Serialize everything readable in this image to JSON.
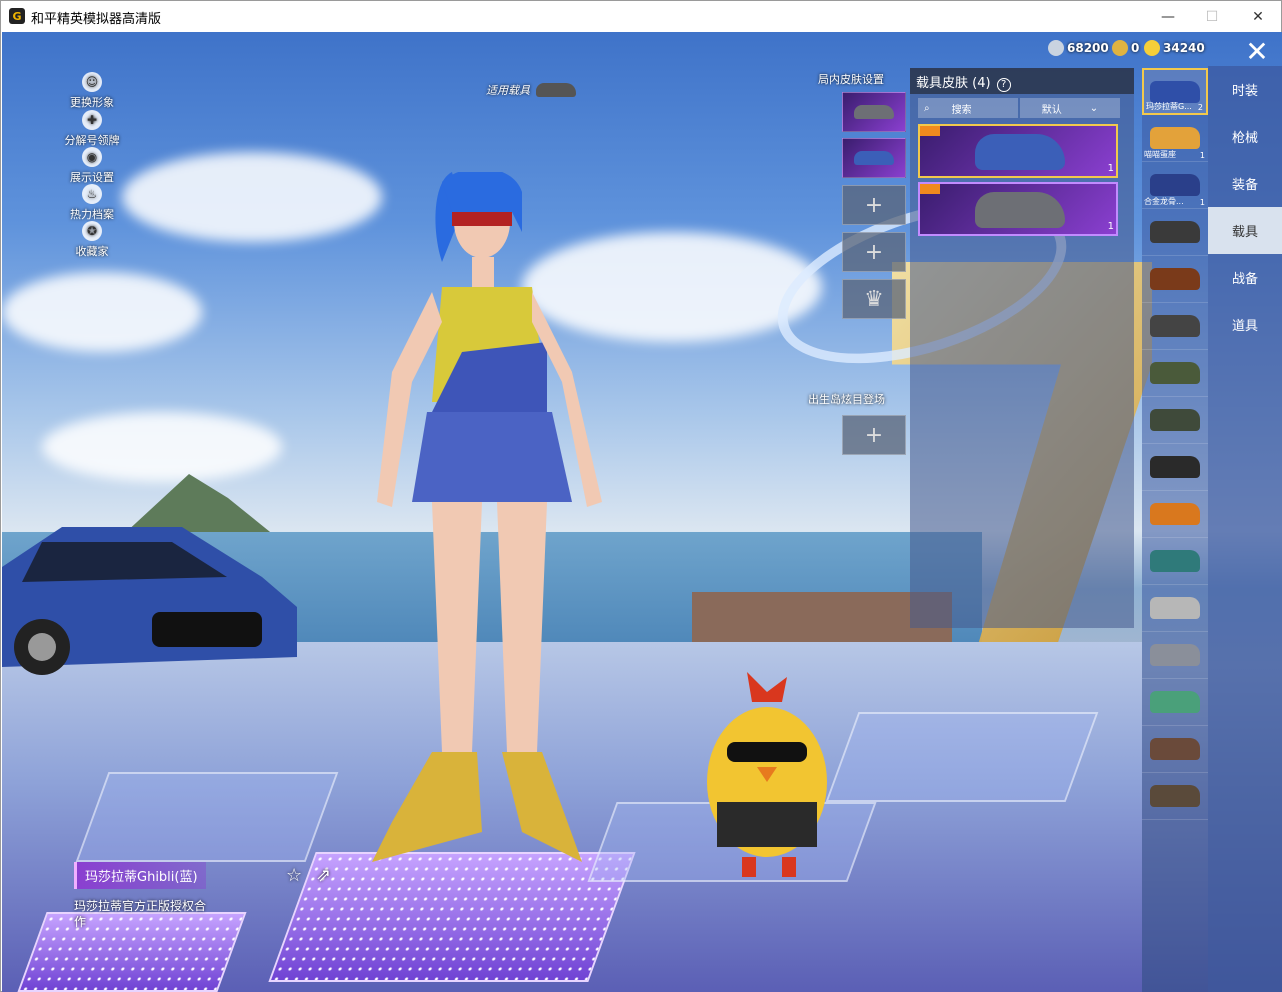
{
  "window": {
    "title": "和平精英模拟器高清版",
    "icon_letter": "G",
    "minimize_glyph": "—",
    "maximize_glyph": "☐",
    "close_glyph": "✕"
  },
  "side_menu": [
    {
      "label": "更换形象",
      "icon": "person-icon"
    },
    {
      "label": "分解号领牌",
      "icon": "puzzle-icon"
    },
    {
      "label": "展示设置",
      "icon": "eye-icon"
    },
    {
      "label": "热力档案",
      "icon": "flame-icon"
    },
    {
      "label": "收藏家",
      "icon": "medal-icon"
    }
  ],
  "apply_vehicle": "适用载具",
  "currency": [
    {
      "value": "68200",
      "color": "#c9d3e0"
    },
    {
      "value": "0",
      "color": "#e0b341"
    },
    {
      "value": "34240",
      "color": "#f5cf3a"
    }
  ],
  "close_glyph": "✕",
  "ingame_skin_label": "局内皮肤设置",
  "birth_label": "出生岛炫目登场",
  "slot_add_glyph": "+",
  "slot_crown_glyph": "♛",
  "skin_panel": {
    "title": "载具皮肤 (4)",
    "help_glyph": "?",
    "search_label": "搜索",
    "sort_label": "默认",
    "items": [
      {
        "count": "1",
        "color": "#3b5fb8"
      },
      {
        "count": "1",
        "color": "#6d6f75"
      }
    ]
  },
  "tabs": [
    "时装",
    "枪械",
    "装备",
    "载具",
    "战备",
    "道具"
  ],
  "active_tab": "载具",
  "vehicles": [
    {
      "label": "玛莎拉蒂G...",
      "count": "2",
      "color": "#2f4fa8"
    },
    {
      "label": "喵喵蛋座",
      "count": "1",
      "color": "#e3a23a"
    },
    {
      "label": "合金龙骨...",
      "count": "1",
      "color": "#2a3f8a"
    },
    {
      "label": "",
      "count": "",
      "color": "#3a3a3a"
    },
    {
      "label": "",
      "count": "",
      "color": "#7a3a1a"
    },
    {
      "label": "",
      "count": "",
      "color": "#444444"
    },
    {
      "label": "",
      "count": "",
      "color": "#4a5a3a"
    },
    {
      "label": "",
      "count": "",
      "color": "#3f4a3a"
    },
    {
      "label": "",
      "count": "",
      "color": "#2a2a2a"
    },
    {
      "label": "",
      "count": "",
      "color": "#d9781e"
    },
    {
      "label": "",
      "count": "",
      "color": "#2f7a7a"
    },
    {
      "label": "",
      "count": "",
      "color": "#b7b7b7"
    },
    {
      "label": "",
      "count": "",
      "color": "#8a8f9a"
    },
    {
      "label": "",
      "count": "",
      "color": "#4aa07a"
    },
    {
      "label": "",
      "count": "",
      "color": "#6a4a3a"
    },
    {
      "label": "",
      "count": "",
      "color": "#5a4a3a"
    }
  ],
  "vehicle_name": "玛莎拉蒂Ghibli(蓝)",
  "vehicle_auth": "玛莎拉蒂官方正版授权合作",
  "bottom_icons": {
    "star": "☆",
    "share": "⇗"
  }
}
